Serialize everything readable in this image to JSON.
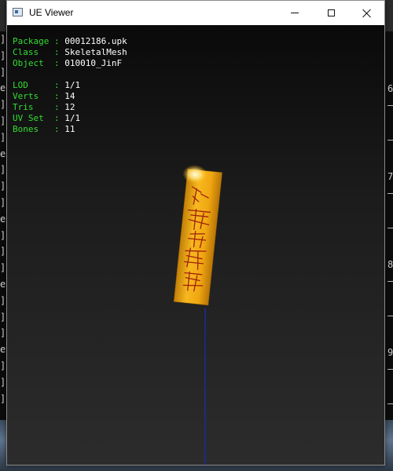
{
  "window": {
    "title": "UE Viewer",
    "icon": "window-app-icon"
  },
  "info_block_1": [
    {
      "key": "Package",
      "sep": " : ",
      "value": "00012186.upk"
    },
    {
      "key": "Class  ",
      "sep": " : ",
      "value": "SkeletalMesh"
    },
    {
      "key": "Object ",
      "sep": " : ",
      "value": "010010_JinF"
    }
  ],
  "info_block_2": [
    {
      "key": "LOD    ",
      "sep": " : ",
      "value": "1/1"
    },
    {
      "key": "Verts  ",
      "sep": " : ",
      "value": "14"
    },
    {
      "key": "Tris   ",
      "sep": " : ",
      "value": "12"
    },
    {
      "key": "UV Set ",
      "sep": " : ",
      "value": "1/1"
    },
    {
      "key": "Bones  ",
      "sep": " : ",
      "value": "11"
    }
  ],
  "colors": {
    "label": "#33dd33",
    "value": "#ffffff",
    "talisman": "#f5b21c",
    "bone_line": "#1a2a9a"
  },
  "background_console": {
    "right_numbers": [
      "6",
      "7",
      "8",
      "9"
    ]
  }
}
